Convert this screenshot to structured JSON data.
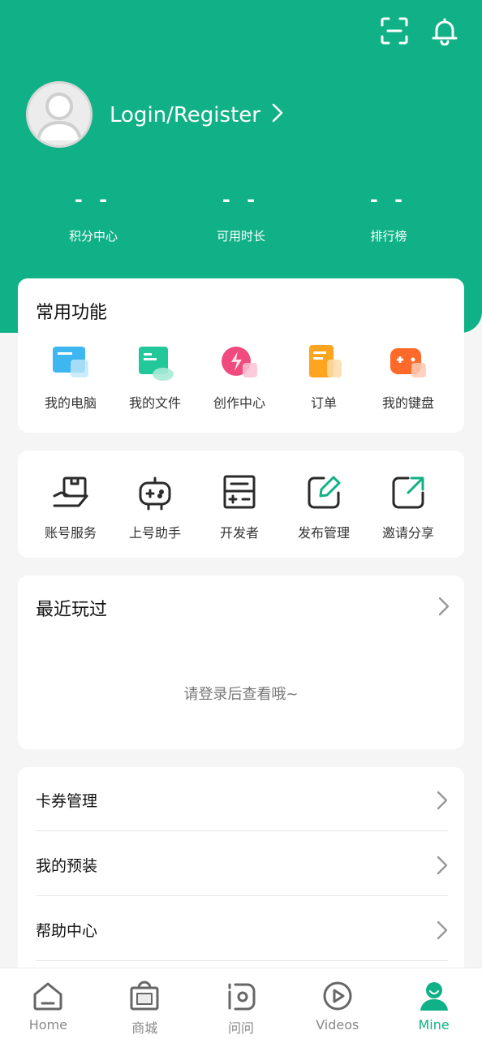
{
  "header": {
    "login_label": "Login/Register",
    "stats": [
      {
        "value": "- -",
        "label": "积分中心"
      },
      {
        "value": "- -",
        "label": "可用时长"
      },
      {
        "value": "- -",
        "label": "排行榜"
      }
    ]
  },
  "common": {
    "title": "常用功能",
    "items": [
      {
        "label": "我的电脑",
        "icon": "computer-icon"
      },
      {
        "label": "我的文件",
        "icon": "file-cloud-icon"
      },
      {
        "label": "创作中心",
        "icon": "creation-icon"
      },
      {
        "label": "订单",
        "icon": "order-icon"
      },
      {
        "label": "我的键盘",
        "icon": "gamepad-keyboard-icon"
      }
    ]
  },
  "services": {
    "items": [
      {
        "label": "账号服务",
        "icon": "account-service-icon"
      },
      {
        "label": "上号助手",
        "icon": "gamepad-icon"
      },
      {
        "label": "开发者",
        "icon": "calculator-icon"
      },
      {
        "label": "发布管理",
        "icon": "edit-icon"
      },
      {
        "label": "邀请分享",
        "icon": "share-icon"
      }
    ]
  },
  "recent": {
    "title": "最近玩过",
    "empty_text": "请登录后查看哦~"
  },
  "menu": {
    "items": [
      "卡券管理",
      "我的预装",
      "帮助中心"
    ]
  },
  "tabbar": {
    "tabs": [
      {
        "label": "Home",
        "icon": "home-icon"
      },
      {
        "label": "商城",
        "icon": "shop-icon"
      },
      {
        "label": "问问",
        "icon": "ask-icon"
      },
      {
        "label": "Videos",
        "icon": "play-icon"
      },
      {
        "label": "Mine",
        "icon": "mine-icon"
      }
    ],
    "active": "Mine"
  },
  "colors": {
    "brand": "#10b186",
    "background": "#f5f5f5"
  }
}
